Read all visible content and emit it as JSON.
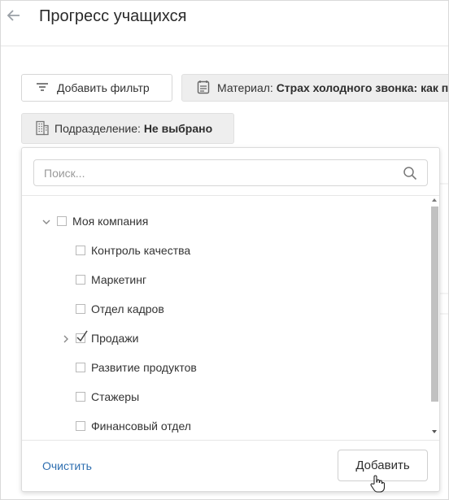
{
  "header": {
    "title": "Прогресс учащихся"
  },
  "filters": {
    "add_filter_label": "Добавить фильтр",
    "material_key": "Материал:",
    "material_value": "Страх холодного звонка: как п",
    "unit_key": "Подразделение:",
    "unit_value": "Не выбрано"
  },
  "dropdown": {
    "search_placeholder": "Поиск...",
    "tree": {
      "root": {
        "label": "Моя компания",
        "checked": false,
        "expanded": true
      },
      "children": [
        {
          "label": "Контроль качества",
          "checked": false
        },
        {
          "label": "Маркетинг",
          "checked": false
        },
        {
          "label": "Отдел кадров",
          "checked": false
        },
        {
          "label": "Продажи",
          "checked": true,
          "has_children": true
        },
        {
          "label": "Развитие продуктов",
          "checked": false
        },
        {
          "label": "Стажеры",
          "checked": false
        },
        {
          "label": "Финансовый отдел",
          "checked": false
        }
      ]
    },
    "clear_label": "Очистить",
    "add_label": "Добавить"
  },
  "icons": {
    "back": "arrow-left-icon",
    "filter": "filter-lines-icon",
    "material": "calendar-icon",
    "unit": "building-icon",
    "search": "search-icon",
    "expand": "chevron-icon",
    "cursor": "hand-pointer-icon"
  },
  "colors": {
    "link": "#2f6fb0",
    "chip_bg": "#eeeeee",
    "scroll_thumb": "#c1c1c1"
  }
}
